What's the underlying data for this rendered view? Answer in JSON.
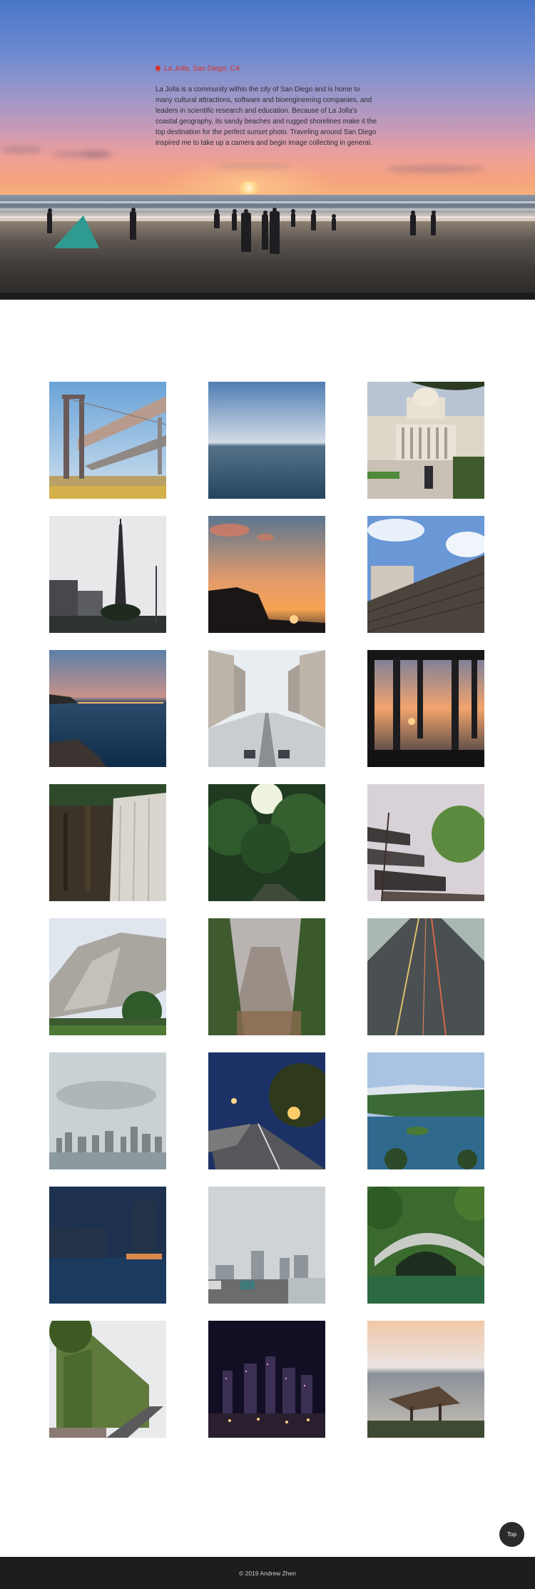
{
  "hero": {
    "location": "La Jolla, San Diego, CA",
    "pin_icon": "map-pin-icon",
    "description": "La Jolla is a community within the city of San Diego and is home to many cultural attractions, software and bioengineering companies, and leaders in scientific research and education. Because of La Jolla's coastal geography, its sandy beaches and rugged shorelines make it the top destination for the perfect sunset photo. Traveling around San Diego inspired me to take up a camera and begin image collecting in general.",
    "accent_color": "#d9342b"
  },
  "gallery": {
    "photos": [
      {
        "subject": "bridge"
      },
      {
        "subject": "ocean horizon"
      },
      {
        "subject": "capitol building"
      },
      {
        "subject": "tv tower"
      },
      {
        "subject": "sunset cliff"
      },
      {
        "subject": "ruins facade"
      },
      {
        "subject": "bay bridge dusk"
      },
      {
        "subject": "concrete courtyard"
      },
      {
        "subject": "pier sunset"
      },
      {
        "subject": "waterfall"
      },
      {
        "subject": "forest path"
      },
      {
        "subject": "temple roofs"
      },
      {
        "subject": "granite cliff"
      },
      {
        "subject": "misty forest"
      },
      {
        "subject": "tunnel road"
      },
      {
        "subject": "city skyline cloudy"
      },
      {
        "subject": "riverside walkway night"
      },
      {
        "subject": "lake islands"
      },
      {
        "subject": "night harbor"
      },
      {
        "subject": "hazy city street"
      },
      {
        "subject": "stone arch bridge"
      },
      {
        "subject": "ivy building"
      },
      {
        "subject": "city lights night"
      },
      {
        "subject": "beach hut"
      }
    ]
  },
  "top_button": {
    "label": "Top"
  },
  "footer": {
    "copyright": "© 2019 Andrew Zhen"
  }
}
